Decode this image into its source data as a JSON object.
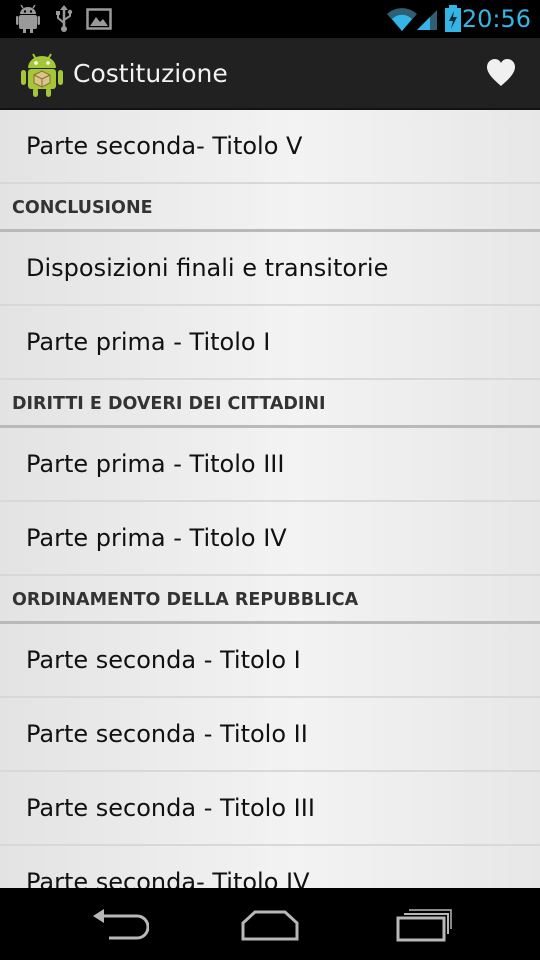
{
  "status_bar": {
    "time": "20:56",
    "time_color": "#33b5e5",
    "left_icons": [
      "android-debug-icon",
      "usb-icon",
      "image-icon"
    ],
    "right_icons": [
      "wifi-icon",
      "signal-icon",
      "battery-charging-icon"
    ]
  },
  "action_bar": {
    "title": "Costituzione",
    "app_icon": "android-app-icon",
    "action_icon": "heart-icon"
  },
  "list": {
    "rows": [
      {
        "type": "item",
        "label": "Parte seconda- Titolo V"
      },
      {
        "type": "header",
        "label": "CONCLUSIONE"
      },
      {
        "type": "item",
        "label": "Disposizioni finali e transitorie"
      },
      {
        "type": "item",
        "label": "Parte prima - Titolo I"
      },
      {
        "type": "header",
        "label": "DIRITTI E DOVERI DEI CITTADINI"
      },
      {
        "type": "item",
        "label": "Parte prima - Titolo III"
      },
      {
        "type": "item",
        "label": "Parte prima - Titolo IV"
      },
      {
        "type": "header",
        "label": "ORDINAMENTO DELLA REPUBBLICA"
      },
      {
        "type": "item",
        "label": "Parte seconda - Titolo I"
      },
      {
        "type": "item",
        "label": "Parte seconda - Titolo II"
      },
      {
        "type": "item",
        "label": "Parte seconda - Titolo III"
      },
      {
        "type": "item",
        "label": "Parte seconda- Titolo IV"
      }
    ]
  },
  "nav_bar": {
    "buttons": [
      "back-icon",
      "home-icon",
      "recent-apps-icon"
    ]
  }
}
